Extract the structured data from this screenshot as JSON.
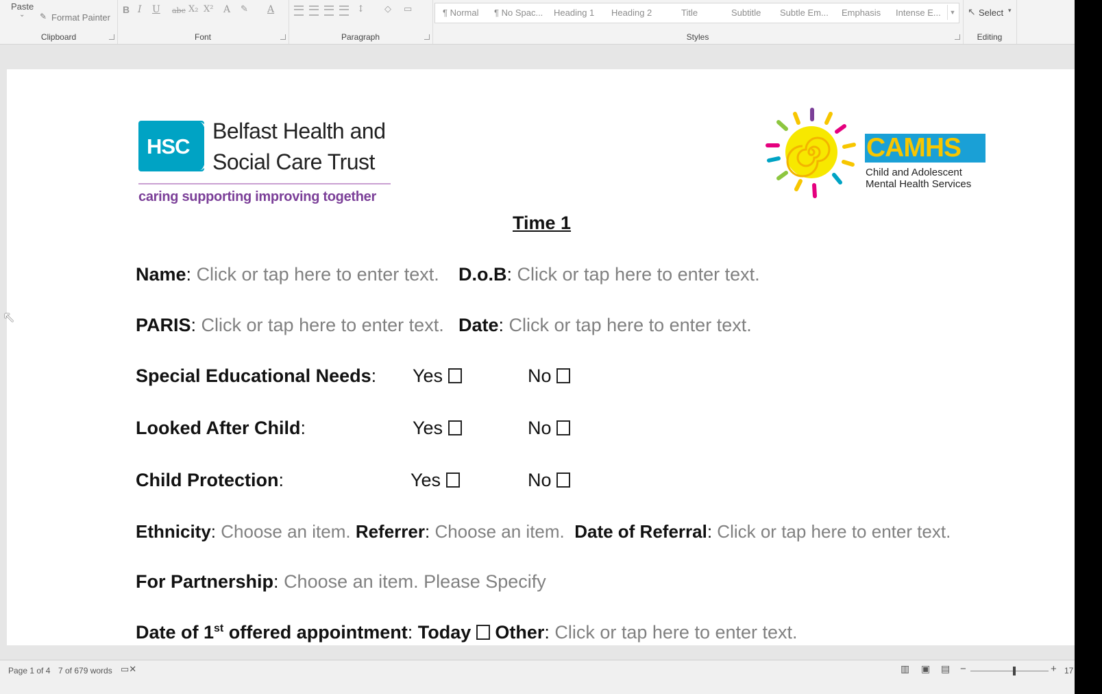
{
  "ribbon": {
    "paste_label": "Paste",
    "format_painter_label": "Format Painter",
    "groups": {
      "clipboard": "Clipboard",
      "font": "Font",
      "paragraph": "Paragraph",
      "styles": "Styles",
      "editing": "Editing"
    },
    "font_buttons": [
      "B",
      "I",
      "U",
      "abc",
      "X₂",
      "X²",
      "A",
      "A"
    ],
    "styles": [
      "¶ Normal",
      "¶ No Spac...",
      "Heading 1",
      "Heading 2",
      "Title",
      "Subtitle",
      "Subtle Em...",
      "Emphasis",
      "Intense E..."
    ],
    "select_label": "Select"
  },
  "document": {
    "logo_left": {
      "mark": "HSC",
      "name_line1": "Belfast Health and",
      "name_line2": "Social Care Trust",
      "tagline": "caring supporting improving together"
    },
    "logo_right": {
      "mark": "CAMHS",
      "sub_line1": "Child and Adolescent",
      "sub_line2": "Mental Health Services"
    },
    "title": "Time 1",
    "name_label": "Name",
    "name_value": "Click or tap here to enter text.",
    "dob_label": "D.o.B",
    "dob_value": "Click or tap here to enter text.",
    "paris_label": "PARIS",
    "paris_value": "Click or tap here to enter text.",
    "date_label": "Date",
    "date_value": "Click or tap here to enter text.",
    "sen_label": "Special Educational Needs",
    "lac_label": "Looked After Child",
    "cp_label": "Child Protection",
    "yes_label": "Yes",
    "no_label": "No",
    "ethnicity_label": "Ethnicity",
    "ethnicity_value": "Choose an item.",
    "referrer_label": "Referrer",
    "referrer_value": "Choose an item.",
    "referral_date_label": "Date of Referral",
    "referral_date_value": "Click or tap here to enter text.",
    "partnership_label": "For Partnership",
    "partnership_value": "Choose an item. Please Specify",
    "appt_label_pre": "Date of 1",
    "appt_label_sup": "st",
    "appt_label_post": " offered appointment",
    "today_label": "Today",
    "other_label": "Other",
    "other_value": "Click or tap here to enter text."
  },
  "status": {
    "page": "Page 1 of 4",
    "words": "7 of 679 words",
    "zoom": "17"
  }
}
